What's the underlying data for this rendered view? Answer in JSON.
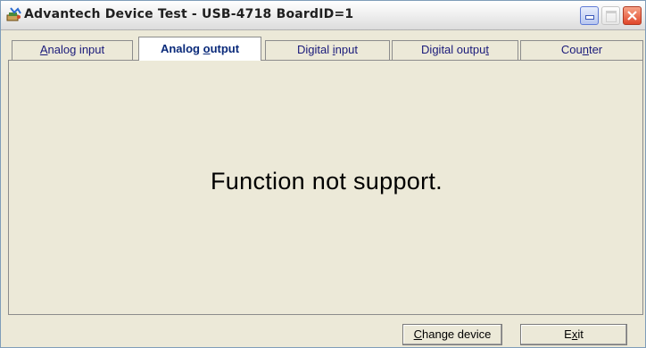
{
  "window": {
    "title": "Advantech Device Test - USB-4718 BoardID=1",
    "icon": "device-test-app-icon"
  },
  "tabs": [
    {
      "label_pre": "",
      "label_ul": "A",
      "label_post": "nalog input",
      "active": false
    },
    {
      "label_pre": "Analog ",
      "label_ul": "o",
      "label_post": "utput",
      "active": true
    },
    {
      "label_pre": "Digital ",
      "label_ul": "i",
      "label_post": "nput",
      "active": false
    },
    {
      "label_pre": "Digital outpu",
      "label_ul": "t",
      "label_post": "",
      "active": false
    },
    {
      "label_pre": "Cou",
      "label_ul": "n",
      "label_post": "ter",
      "active": false
    }
  ],
  "panel": {
    "message": "Function not support."
  },
  "footer": {
    "change_device_pre": "",
    "change_device_ul": "C",
    "change_device_post": "hange device",
    "exit_pre": "E",
    "exit_ul": "x",
    "exit_post": "it"
  },
  "colors": {
    "tab_text": "#1a1a7a",
    "close_button": "#e0462a",
    "minimize_button": "#b7c6ef"
  }
}
